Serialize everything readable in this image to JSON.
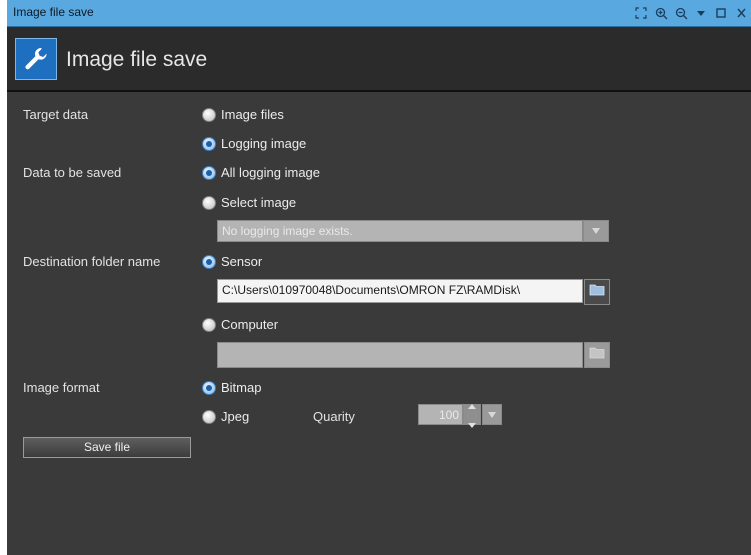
{
  "window": {
    "title": "Image file save"
  },
  "header": {
    "title": "Image file save"
  },
  "target_data": {
    "label": "Target data",
    "options": [
      "Image files",
      "Logging image"
    ],
    "selected": "Logging image"
  },
  "data_to_be_saved": {
    "label": "Data to be saved",
    "options": [
      "All logging image",
      "Select image"
    ],
    "selected": "All logging image",
    "image_select_value": "No logging image exists."
  },
  "destination": {
    "label": "Destination folder name",
    "sensor_label": "Sensor",
    "sensor_path": "C:\\Users\\010970048\\Documents\\OMRON FZ\\RAMDisk\\",
    "computer_label": "Computer",
    "computer_path": "",
    "selected": "Sensor"
  },
  "image_format": {
    "label": "Image format",
    "options": [
      "Bitmap",
      "Jpeg"
    ],
    "selected": "Bitmap",
    "quality_label": "Quarity",
    "quality_value": "100"
  },
  "actions": {
    "save_label": "Save file"
  }
}
